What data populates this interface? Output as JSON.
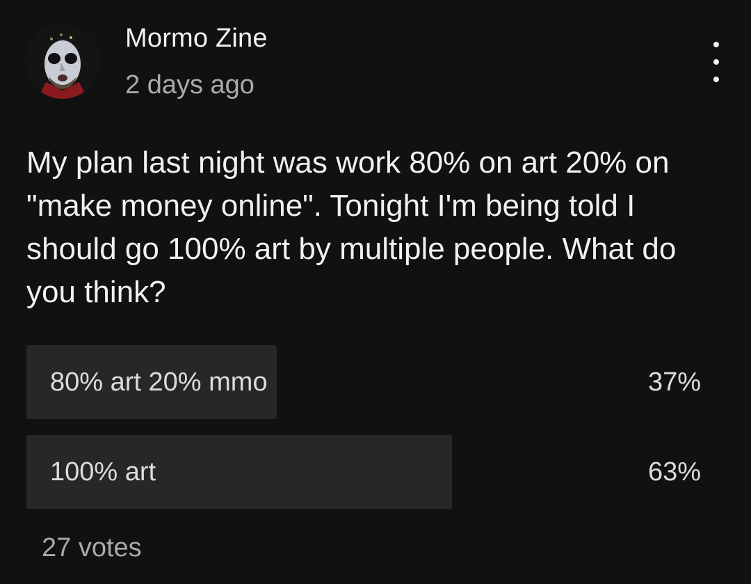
{
  "author": {
    "name": "Mormo Zine",
    "time": "2 days ago"
  },
  "post": {
    "text": "My plan last night was work 80% on art 20% on \"make money online\". Tonight I'm being told I should go 100% art by multiple people. What do you think?"
  },
  "poll": {
    "options": [
      {
        "label": "80% art 20% mmo",
        "percent_label": "37%",
        "fraction": 0.37
      },
      {
        "label": "100% art",
        "percent_label": "63%",
        "fraction": 0.63
      }
    ],
    "votes_label": "27 votes"
  },
  "icons": {
    "menu": "more-vertical-icon"
  },
  "colors": {
    "background": "#111111",
    "poll_fill": "#272727",
    "text_primary": "#f1f1f1",
    "text_secondary": "#aaaaaa"
  }
}
